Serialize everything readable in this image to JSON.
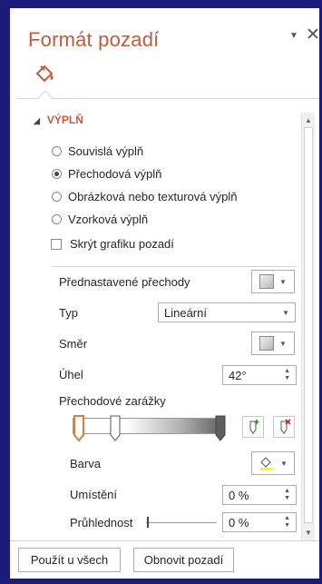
{
  "pane": {
    "title": "Formát pozadí",
    "menu_glyph": "▼",
    "close_glyph": "✕",
    "tab_icon": "paint-bucket-icon"
  },
  "section": {
    "title": "VÝPLŇ",
    "expanded": true
  },
  "fill_options": [
    {
      "label": "Souvislá výplň",
      "selected": false
    },
    {
      "label": "Přechodová výplň",
      "selected": true
    },
    {
      "label": "Obrázková nebo texturová výplň",
      "selected": false
    },
    {
      "label": "Vzorková výplň",
      "selected": false
    }
  ],
  "hide_graphics": {
    "label": "Skrýt grafiku pozadí",
    "checked": false
  },
  "preset": {
    "label": "Přednastavené přechody"
  },
  "type": {
    "label": "Typ",
    "value": "Lineární"
  },
  "direction": {
    "label": "Směr"
  },
  "angle": {
    "label": "Úhel",
    "value": "42°"
  },
  "gradient_stops": {
    "label": "Přechodové zarážky",
    "stops": [
      0,
      0.3,
      1
    ],
    "colors": {
      "start": "#ffffff",
      "end": "#5e5e5e",
      "selected_outline": "#e07b3c"
    }
  },
  "color": {
    "label": "Barva",
    "highlight": "#ffff00"
  },
  "position": {
    "label": "Umístění",
    "value": "0 %"
  },
  "transparency": {
    "label": "Průhlednost",
    "value": "0 %"
  },
  "footer": {
    "apply_all": "Použít u všech",
    "reset": "Obnovit pozadí"
  },
  "accent_color": "#c55a3a"
}
